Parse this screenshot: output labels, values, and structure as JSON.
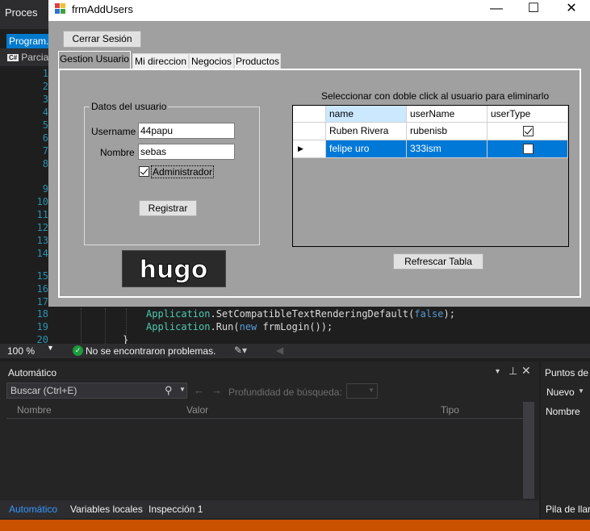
{
  "vs": {
    "title": "Proces",
    "doc_tab": "Program.",
    "class_selector": "Parcia",
    "cs_badge": "C#",
    "line_numbers": [
      "1",
      "2",
      "3",
      "4",
      "5",
      "6",
      "7",
      "8",
      "9",
      "10",
      "11",
      "12",
      "13",
      "14",
      "15",
      "16",
      "17",
      "18",
      "19",
      "20"
    ],
    "code_line_18": {
      "cls": "Application",
      "rest1": ".SetCompatibleTextRenderingDefault(",
      "kw": "false",
      "rest2": ");"
    },
    "code_line_19": {
      "cls": "Application",
      "rest1": ".Run(",
      "kw": "new",
      "rest2": " frmLogin());"
    },
    "code_line_20": "}",
    "zoom": "100 %",
    "status_message": "No se encontraron problemas.",
    "auto_panel": {
      "title": "Automático",
      "search_placeholder": "Buscar (Ctrl+E)",
      "depth_label": "Profundidad de búsqueda:",
      "columns": [
        "Nombre",
        "Valor",
        "Tipo"
      ]
    },
    "bottom_tabs": [
      "Automático",
      "Variables locales",
      "Inspección 1"
    ],
    "right_panel": {
      "title": "Puntos de",
      "new_button": "Nuevo",
      "column": "Nombre",
      "bottom_tab": "Pila de llar"
    },
    "colors": {
      "accent": "#007acc",
      "status_bar": "#ca5100"
    }
  },
  "form": {
    "title": "frmAddUsers",
    "logout_button": "Cerrar Sesión",
    "tabs": [
      {
        "label": "Gestion Usuario",
        "active": true
      },
      {
        "label": "Mi direccion",
        "active": false
      },
      {
        "label": "Negocios",
        "active": false
      },
      {
        "label": "Productos",
        "active": false
      }
    ],
    "user_group": {
      "legend": "Datos del usuario",
      "username_label": "Username",
      "username_value": "44papu",
      "name_label": "Nombre",
      "name_value": "sebas",
      "admin_label": "Administrador",
      "admin_checked": true,
      "register_button": "Registrar"
    },
    "logo_text": "hugo",
    "grid": {
      "caption": "Seleccionar con doble click al usuario para eliminarlo",
      "columns": [
        "name",
        "userName",
        "userType"
      ],
      "rows": [
        {
          "name": "Ruben Rivera",
          "userName": "rubenisb",
          "userType": true,
          "selected": false
        },
        {
          "name": "felipe uro",
          "userName": "333ism",
          "userType": false,
          "selected": true
        }
      ]
    },
    "refresh_button": "Refrescar Tabla"
  }
}
